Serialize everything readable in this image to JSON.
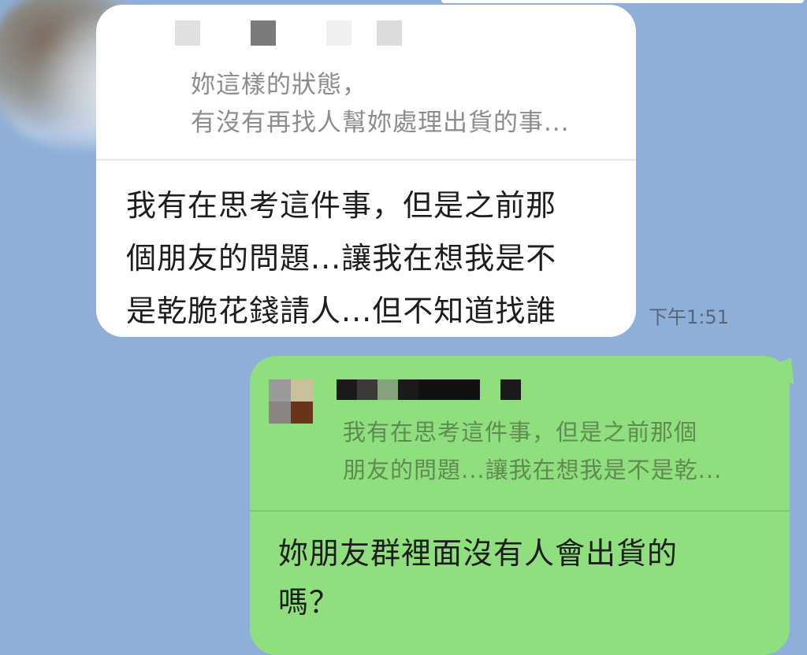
{
  "chat": {
    "received": {
      "quote_line_1": "妳這樣的狀態，",
      "quote_line_2": "有沒有再找人幫妳處理出貨的事...",
      "message_lines": [
        "我有在思考這件事，但是之前那",
        "個朋友的問題...讓我在想我是不",
        "是乾脆花錢請人...但不知道找誰"
      ],
      "time": "下午1:51"
    },
    "sent": {
      "quote_line_1": "我有在思考這件事，但是之前那個",
      "quote_line_2": "朋友的問題...讓我在想我是不是乾...",
      "message_lines": [
        "妳朋友群裡面沒有人會出貨的",
        "嗎？"
      ]
    }
  },
  "colors": {
    "background": "#8eafd8",
    "received_bubble": "#ffffff",
    "sent_bubble": "#90df7e",
    "quote_text_received": "#8c8c8c",
    "quote_text_sent": "#5f8b52",
    "timestamp": "#54657c"
  },
  "censor_blocks": {
    "received_name": [
      "#e0e0e0",
      "#ffffff",
      "#ffffff",
      "#7a7a7a",
      "#ffffff",
      "#ffffff",
      "#f0f0f0",
      "#ffffff",
      "#dcdcdc"
    ],
    "sent_avatar": [
      "#9a9a9a",
      "#c9c19a",
      "#8a8583",
      "#6a3418"
    ],
    "sent_name": [
      "#1a1a1a",
      "#3a3a3a",
      "#84a27b",
      "#1a1a1a",
      "#111111",
      "#111111",
      "#111111",
      "#90df7e",
      "#1a1a1a"
    ]
  }
}
